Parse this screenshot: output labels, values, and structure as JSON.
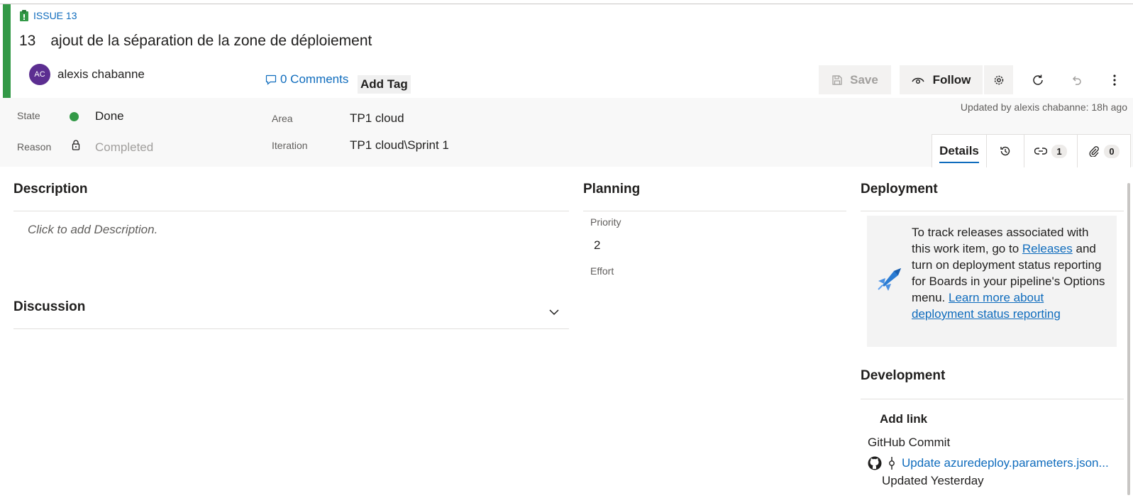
{
  "work_item": {
    "type_label": "ISSUE 13",
    "id": "13",
    "title": "ajout de la séparation de la zone de déploiement",
    "assignee": {
      "initials": "AC",
      "name": "alexis chabanne"
    },
    "comments_label": "0 Comments",
    "add_tag_label": "Add Tag"
  },
  "toolbar": {
    "save_label": "Save",
    "follow_label": "Follow"
  },
  "fields": {
    "state_label": "State",
    "state_value": "Done",
    "reason_label": "Reason",
    "reason_value": "Completed",
    "area_label": "Area",
    "area_value": "TP1 cloud",
    "iteration_label": "Iteration",
    "iteration_value": "TP1 cloud\\Sprint 1",
    "updated_text": "Updated by alexis chabanne: 18h ago"
  },
  "tabs": {
    "details_label": "Details",
    "links_count": "1",
    "attachments_count": "0"
  },
  "description": {
    "title": "Description",
    "placeholder": "Click to add Description."
  },
  "discussion": {
    "title": "Discussion"
  },
  "planning": {
    "title": "Planning",
    "priority_label": "Priority",
    "priority_value": "2",
    "effort_label": "Effort"
  },
  "deployment": {
    "title": "Deployment",
    "text_part1": "To track releases associated with this work item, go to ",
    "releases_link": "Releases",
    "text_part2": " and turn on deployment status reporting for Boards in your pipeline's Options menu. ",
    "learn_link": "Learn more about deployment status reporting"
  },
  "development": {
    "title": "Development",
    "add_link_label": "Add link",
    "group_label": "GitHub Commit",
    "commit_link": "Update azuredeploy.parameters.json...",
    "commit_updated": "Updated Yesterday"
  },
  "colors": {
    "accent": "#339947",
    "link": "#0f6cbd",
    "avatar": "#5c2e91"
  }
}
